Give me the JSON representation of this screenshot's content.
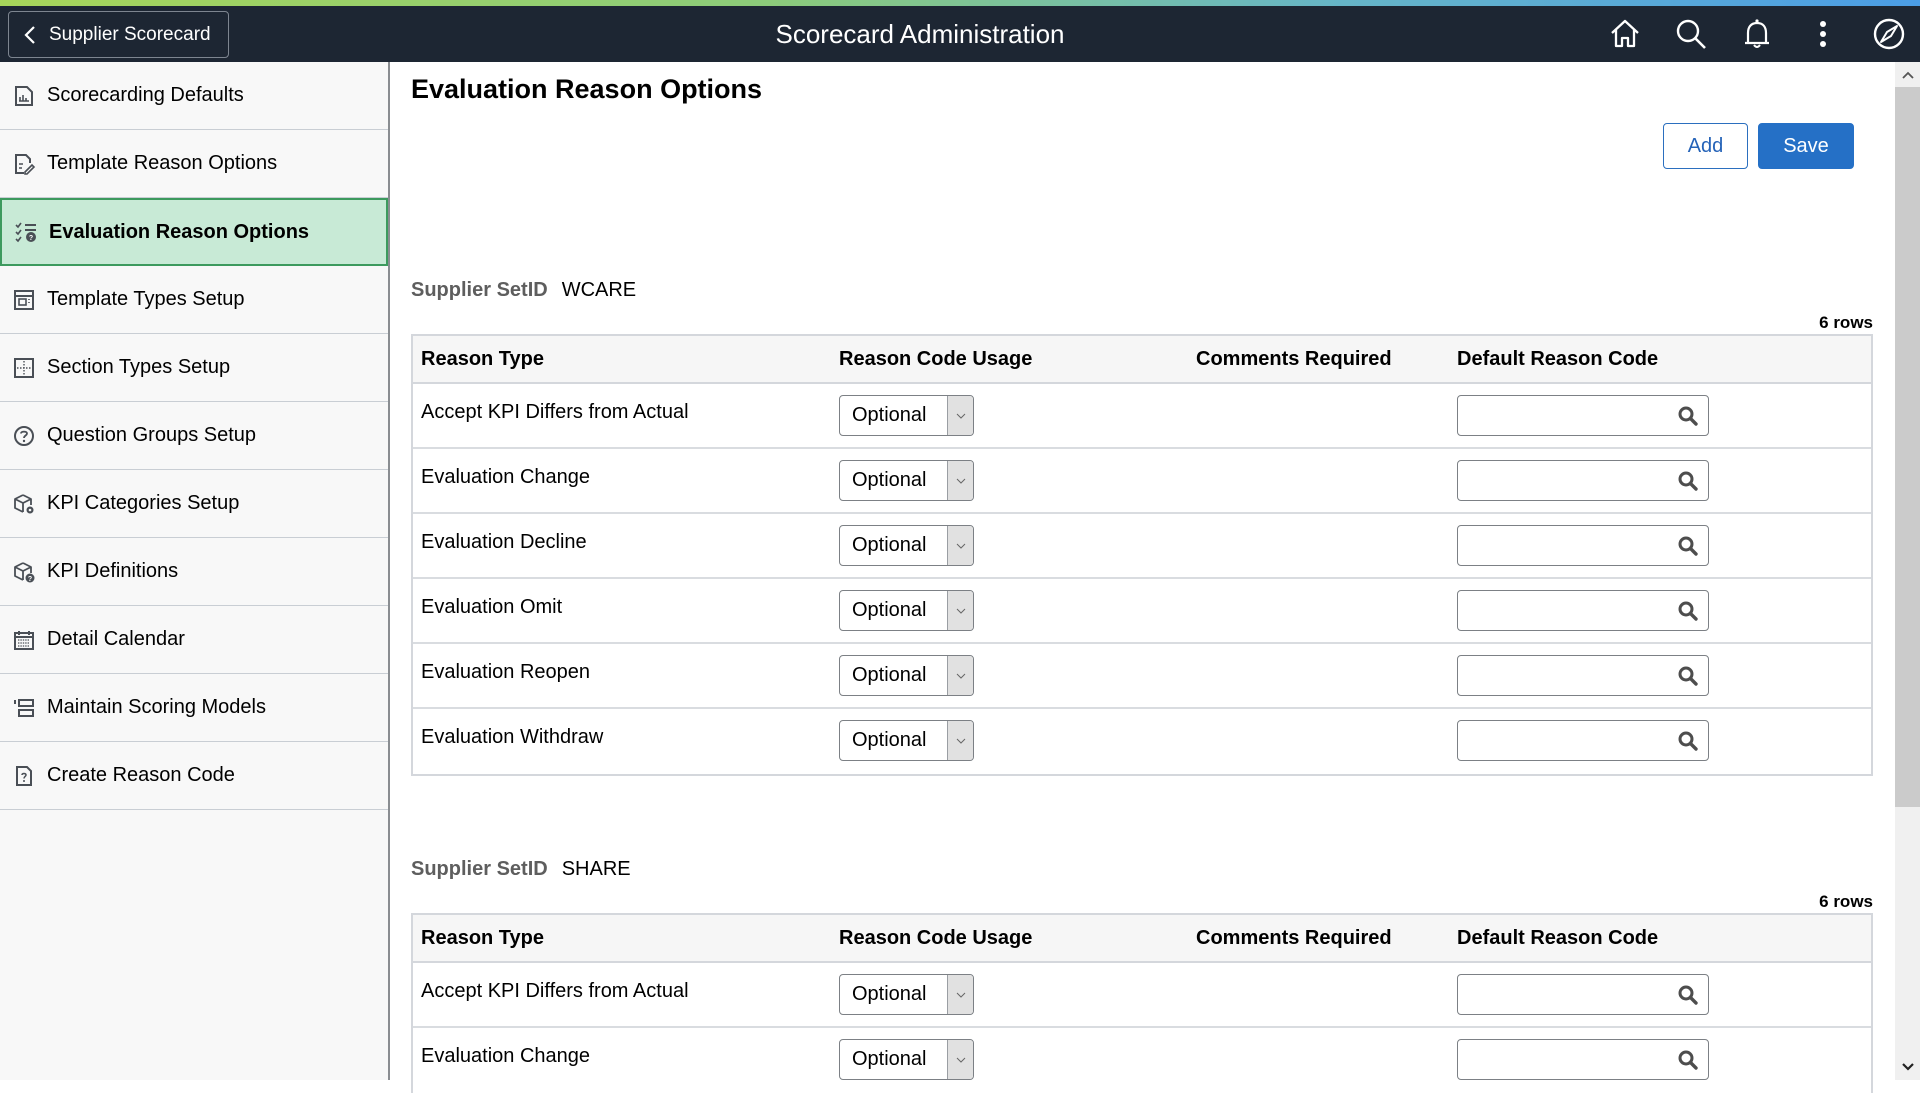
{
  "header": {
    "back_label": "Supplier Scorecard",
    "title": "Scorecard Administration",
    "icons": [
      "home-icon",
      "search-icon",
      "bell-icon",
      "more-vertical-icon",
      "compass-icon"
    ]
  },
  "sidebar": {
    "items": [
      {
        "label": "Scorecarding Defaults",
        "icon": "chart-document-icon",
        "active": false
      },
      {
        "label": "Template Reason Options",
        "icon": "document-edit-icon",
        "active": false
      },
      {
        "label": "Evaluation Reason Options",
        "icon": "checklist-question-icon",
        "active": true
      },
      {
        "label": "Template Types Setup",
        "icon": "template-layout-icon",
        "active": false
      },
      {
        "label": "Section Types Setup",
        "icon": "section-grid-icon",
        "active": false
      },
      {
        "label": "Question Groups Setup",
        "icon": "question-circle-icon",
        "active": false
      },
      {
        "label": "KPI Categories Setup",
        "icon": "cube-gear-icon",
        "active": false
      },
      {
        "label": "KPI Definitions",
        "icon": "cube-question-icon",
        "active": false
      },
      {
        "label": "Detail Calendar",
        "icon": "calendar-icon",
        "active": false
      },
      {
        "label": "Maintain Scoring Models",
        "icon": "list-models-icon",
        "active": false
      },
      {
        "label": "Create Reason Code",
        "icon": "document-question-icon",
        "active": false
      }
    ]
  },
  "main": {
    "title": "Evaluation Reason Options",
    "add_label": "Add",
    "save_label": "Save",
    "columns": [
      "Reason Type",
      "Reason Code Usage",
      "Comments Required",
      "Default Reason Code"
    ],
    "sets": [
      {
        "label": "Supplier SetID",
        "value": "WCARE",
        "rows_count": "6 rows",
        "rows": [
          {
            "reason_type": "Accept KPI Differs from Actual",
            "usage": "Optional",
            "comments_required": "",
            "default_code": ""
          },
          {
            "reason_type": "Evaluation Change",
            "usage": "Optional",
            "comments_required": "",
            "default_code": ""
          },
          {
            "reason_type": "Evaluation Decline",
            "usage": "Optional",
            "comments_required": "",
            "default_code": ""
          },
          {
            "reason_type": "Evaluation Omit",
            "usage": "Optional",
            "comments_required": "",
            "default_code": ""
          },
          {
            "reason_type": "Evaluation Reopen",
            "usage": "Optional",
            "comments_required": "",
            "default_code": ""
          },
          {
            "reason_type": "Evaluation Withdraw",
            "usage": "Optional",
            "comments_required": "",
            "default_code": ""
          }
        ]
      },
      {
        "label": "Supplier SetID",
        "value": "SHARE",
        "rows_count": "6 rows",
        "rows": [
          {
            "reason_type": "Accept KPI Differs from Actual",
            "usage": "Optional",
            "comments_required": "",
            "default_code": ""
          },
          {
            "reason_type": "Evaluation Change",
            "usage": "Optional",
            "comments_required": "",
            "default_code": ""
          }
        ]
      }
    ]
  },
  "colors": {
    "header_bg": "#1d2633",
    "active_item_bg": "#c8ead6",
    "active_item_border": "#3d9a5e",
    "primary_button": "#2570c6"
  }
}
